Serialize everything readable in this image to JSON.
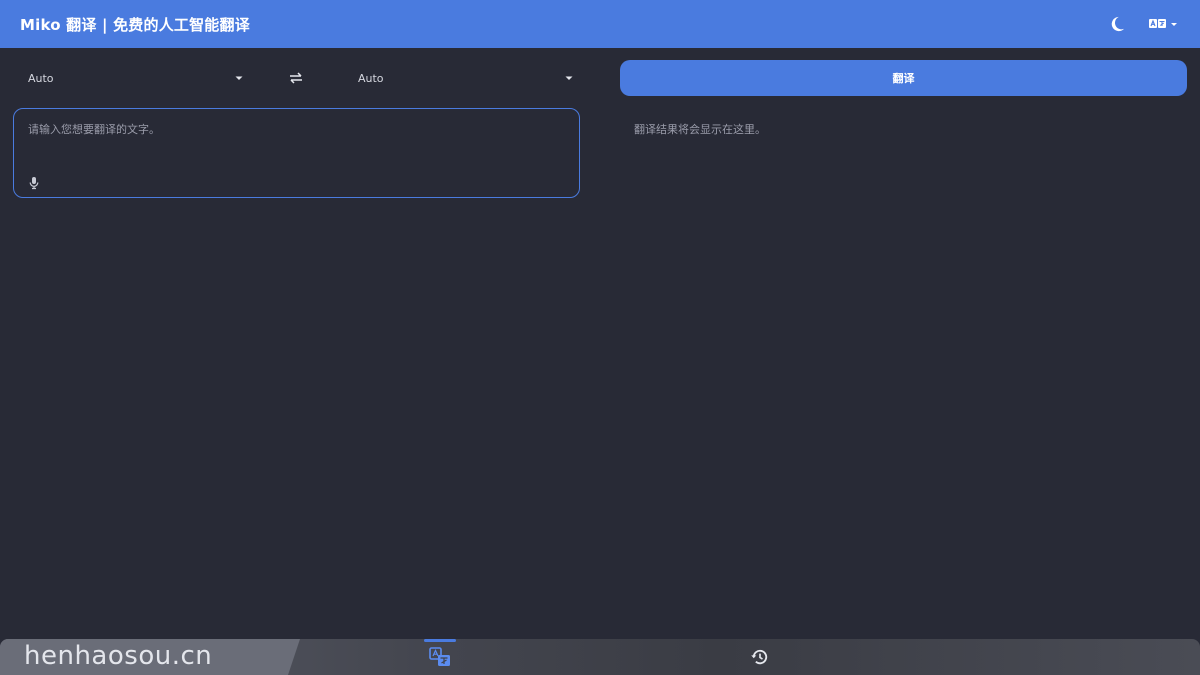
{
  "header": {
    "title": "Miko 翻译 | 免费的人工智能翻译",
    "icons": [
      "moon-icon",
      "translate-language-icon",
      "caret-down-icon"
    ]
  },
  "languages": {
    "source": "Auto",
    "target": "Auto"
  },
  "translate_button": "翻译",
  "input": {
    "value": "",
    "placeholder": "请输入您想要翻译的文字。"
  },
  "result": {
    "placeholder": "翻译结果将会显示在这里。"
  },
  "bottom_nav": {
    "items": [
      "translate-icon",
      "history-icon"
    ],
    "active": "translate"
  },
  "watermark": "henhaosou.cn",
  "colors": {
    "accent": "#4a7bdf",
    "background": "#282a36"
  }
}
